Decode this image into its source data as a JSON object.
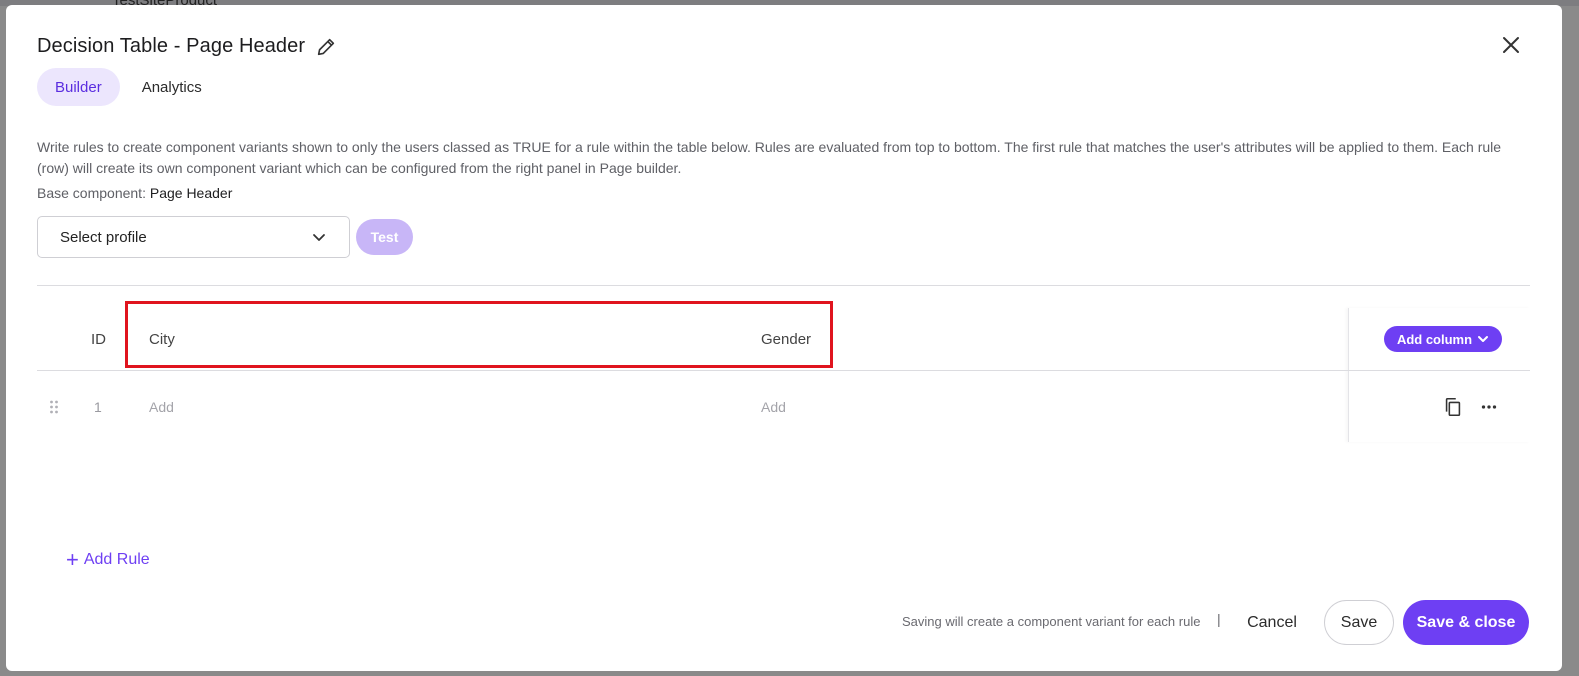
{
  "backdrop": {
    "text": "TestSiteProduct"
  },
  "dialog": {
    "title": "Decision Table - Page Header",
    "tabs": [
      {
        "label": "Builder",
        "active": true
      },
      {
        "label": "Analytics",
        "active": false
      }
    ],
    "description": "Write rules to create component variants shown to only the users classed as TRUE for a rule within the table below. Rules are evaluated from top to bottom. The first rule that matches the user's attributes will be applied to them. Each rule (row) will create its own component variant which can be configured from the right panel in Page builder.",
    "base_component_label": "Base component:",
    "base_component_value": "Page Header",
    "profile_select": {
      "value": "Select profile"
    },
    "test_label": "Test",
    "table": {
      "columns": [
        "ID",
        "City",
        "Gender"
      ],
      "add_column_label": "Add column",
      "rows": [
        {
          "id": "1",
          "city": "Add",
          "gender": "Add"
        }
      ]
    },
    "add_rule_label": "Add Rule",
    "footer": {
      "note": "Saving will create a component variant for each rule",
      "separator": "|",
      "cancel_label": "Cancel",
      "save_label": "Save",
      "save_close_label": "Save & close"
    }
  },
  "colors": {
    "accent": "#6e3ff3",
    "accent_light": "#ece6fd",
    "disabled_button": "#c8b6f7",
    "highlight_box": "#e0141e"
  },
  "icons": [
    "pencil-icon",
    "close-icon",
    "chevron-down-icon",
    "drag-handle-icon",
    "copy-icon",
    "more-horizontal-icon",
    "plus-icon"
  ]
}
